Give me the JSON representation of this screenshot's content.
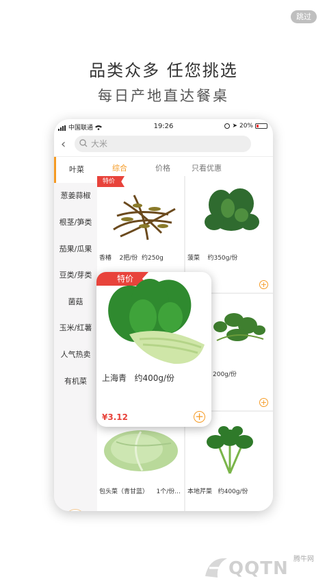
{
  "skip_label": "跳过",
  "headline": "品类众多  任您挑选",
  "subheadline": "每日产地直达餐桌",
  "status": {
    "carrier": "中国联通",
    "time": "19:26",
    "battery": "20%"
  },
  "search": {
    "placeholder": "大米"
  },
  "categories": [
    "叶菜",
    "葱姜蒜椒",
    "根茎/笋类",
    "茄果/瓜果",
    "豆类/芽类",
    "菌菇",
    "玉米/红薯",
    "人气热卖",
    "有机菜"
  ],
  "tabs": [
    "综合",
    "价格",
    "只看优惠"
  ],
  "products": [
    {
      "name": "香椿",
      "spec": "2把/份",
      "weight": "约250g",
      "tag": "特价"
    },
    {
      "name": "菠菜",
      "spec": "约350g/份"
    },
    {
      "name": "",
      "spec": "200g/份"
    },
    {
      "name": "包头菜（青甘蓝）",
      "spec": "1个/份..."
    },
    {
      "name": "本地芹菜",
      "spec": "约400g/份"
    }
  ],
  "popup": {
    "tag": "特价",
    "name": "上海青",
    "spec": "约400g/份",
    "price": "¥3.12"
  },
  "watermark": {
    "brand": "QQTN",
    "sub": "腾牛网"
  },
  "colors": {
    "accent": "#f59a23",
    "tag": "#e8433b",
    "price": "#e8433b"
  }
}
